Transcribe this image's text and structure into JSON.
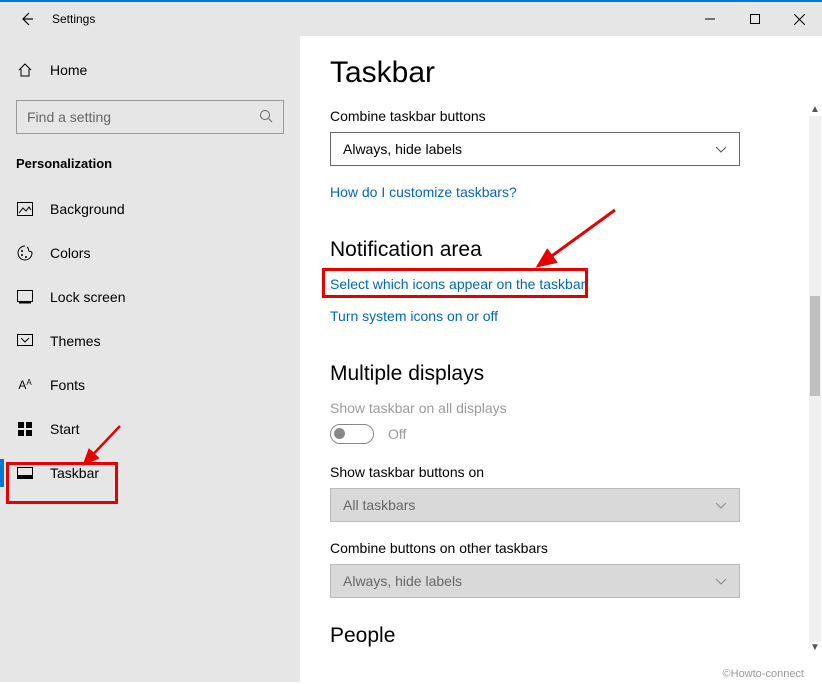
{
  "window": {
    "title": "Settings"
  },
  "sidebar": {
    "home": "Home",
    "search_placeholder": "Find a setting",
    "category": "Personalization",
    "items": [
      {
        "label": "Background"
      },
      {
        "label": "Colors"
      },
      {
        "label": "Lock screen"
      },
      {
        "label": "Themes"
      },
      {
        "label": "Fonts"
      },
      {
        "label": "Start"
      },
      {
        "label": "Taskbar"
      }
    ]
  },
  "main": {
    "title": "Taskbar",
    "combine_label": "Combine taskbar buttons",
    "combine_value": "Always, hide labels",
    "help_link": "How do I customize taskbars?",
    "notif_section": "Notification area",
    "select_icons_link": "Select which icons appear on the taskbar",
    "system_icons_link": "Turn system icons on or off",
    "multi_section": "Multiple displays",
    "show_all_label": "Show taskbar on all displays",
    "toggle_off": "Off",
    "show_on_label": "Show taskbar buttons on",
    "show_on_value": "All taskbars",
    "combine_other_label": "Combine buttons on other taskbars",
    "combine_other_value": "Always, hide labels",
    "people_section": "People"
  },
  "watermark": "©Howto-connect"
}
